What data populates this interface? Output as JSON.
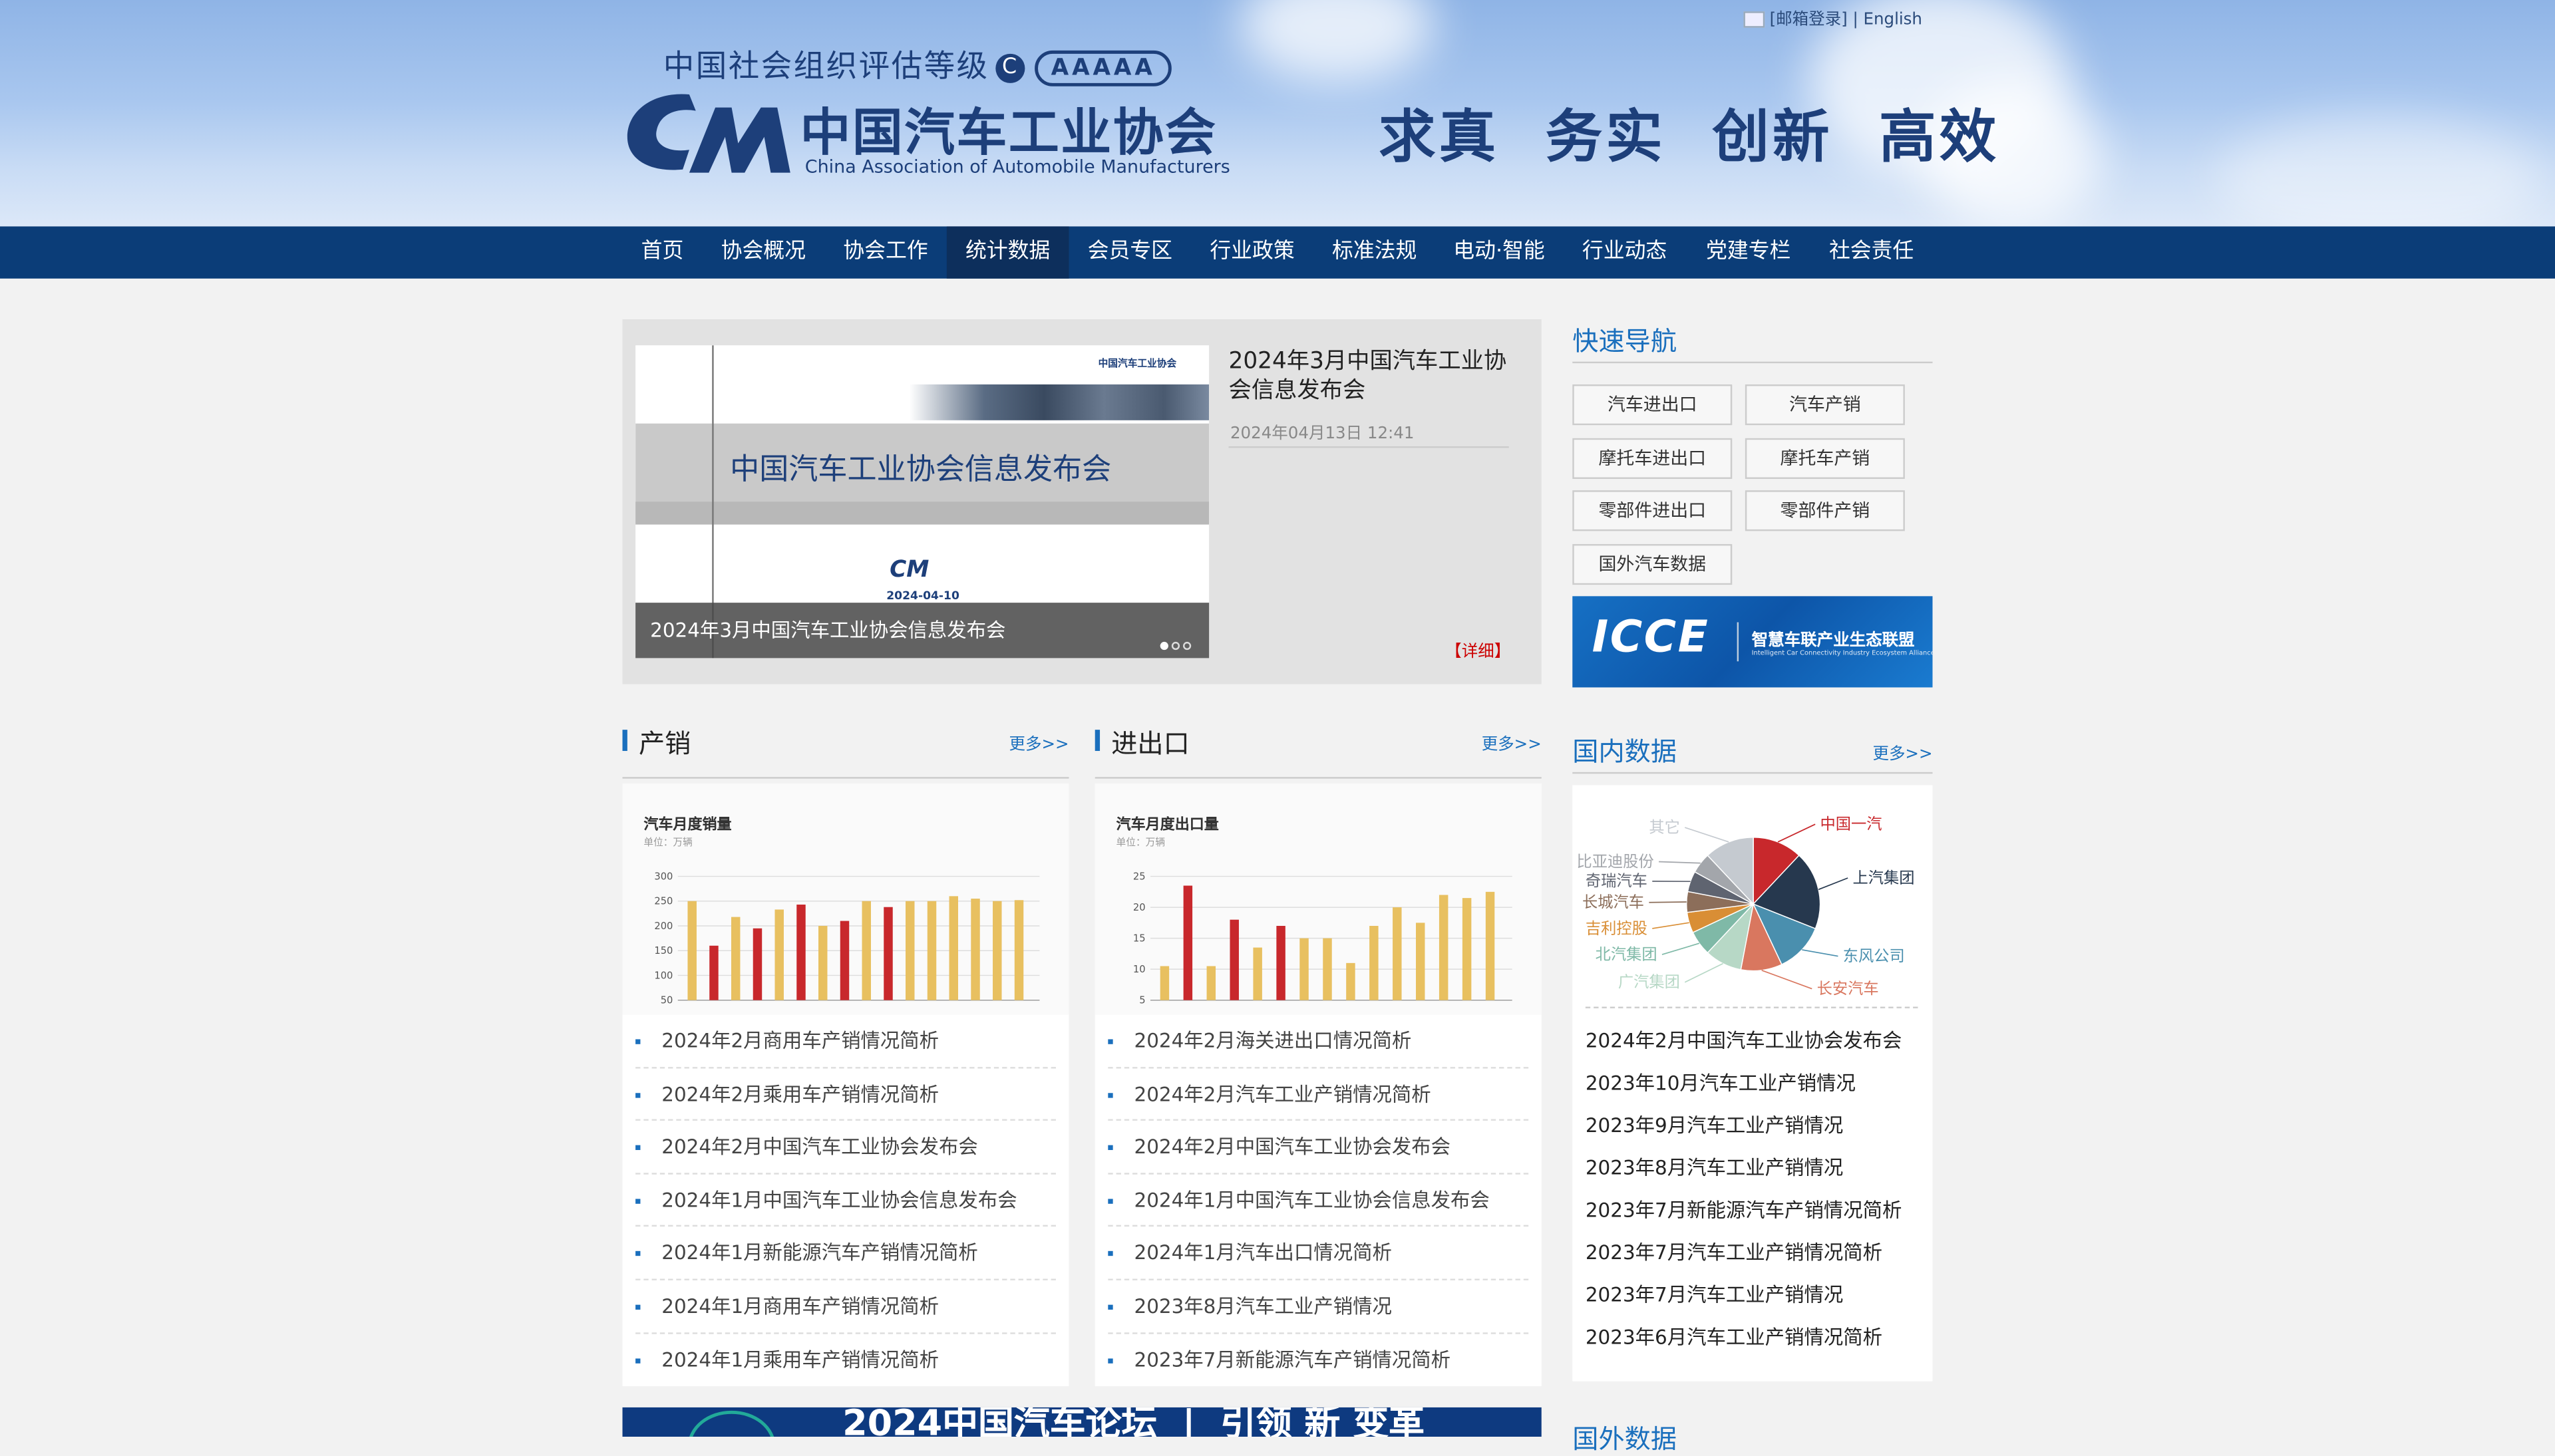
{
  "top_links": {
    "mail_login": "[邮箱登录]",
    "english": "| English"
  },
  "header": {
    "rating_text": "中国社会组织评估等级",
    "rating_mark": "C",
    "rating_grade": "AAAAA",
    "logo_mark": "CAM",
    "org_name_cn": "中国汽车工业协会",
    "org_name_en": "China Association of Automobile Manufacturers",
    "slogan": "求真  务实  创新  高效"
  },
  "nav": {
    "items": [
      "首页",
      "协会概况",
      "协会工作",
      "统计数据",
      "会员专区",
      "行业政策",
      "标准法规",
      "电动·智能",
      "行业动态",
      "党建专栏",
      "社会责任"
    ],
    "active": "统计数据"
  },
  "featured": {
    "image_logo_text": "中国汽车工业协会",
    "image_title": "中国汽车工业协会信息发布会",
    "image_cm": "CM",
    "image_date": "2024-04-10",
    "caption": "2024年3月中国汽车工业协会信息发布会",
    "title": "2024年3月中国汽车工业协会信息发布会",
    "date": "2024年04月13日 12:41",
    "detail_label": "【详细】",
    "slide_count": 3,
    "active_slide": 1
  },
  "sales_section": {
    "title": "产销",
    "more": "更多>>",
    "chart_title": "汽车月度销量",
    "chart_unit": "单位：万辆",
    "items": [
      "2024年2月商用车产销情况简析",
      "2024年2月乘用车产销情况简析",
      "2024年2月中国汽车工业协会发布会",
      "2024年1月中国汽车工业协会信息发布会",
      "2024年1月新能源汽车产销情况简析",
      "2024年1月商用车产销情况简析",
      "2024年1月乘用车产销情况简析"
    ]
  },
  "trade_section": {
    "title": "进出口",
    "more": "更多>>",
    "chart_title": "汽车月度出口量",
    "chart_unit": "单位：万辆",
    "items": [
      "2024年2月海关进出口情况简析",
      "2024年2月汽车工业产销情况简析",
      "2024年2月中国汽车工业协会发布会",
      "2024年1月中国汽车工业协会信息发布会",
      "2024年1月汽车出口情况简析",
      "2023年8月汽车工业产销情况",
      "2023年7月新能源汽车产销情况简析"
    ]
  },
  "quick_nav": {
    "title": "快速导航",
    "buttons": [
      "汽车进出口",
      "汽车产销",
      "摩托车进出口",
      "摩托车产销",
      "零部件进出口",
      "零部件产销",
      "国外汽车数据"
    ]
  },
  "icce_banner": {
    "logo_text": "ICCE",
    "cn": "智慧车联产业生态联盟",
    "en": "Intelligent Car Connectivity Industry Ecosystem Alliance"
  },
  "domestic": {
    "title": "国内数据",
    "more": "更多>>",
    "items": [
      "2024年2月中国汽车工业协会发布会",
      "2023年10月汽车工业产销情况",
      "2023年9月汽车工业产销情况",
      "2023年8月汽车工业产销情况",
      "2023年7月新能源汽车产销情况简析",
      "2023年7月汽车工业产销情况简析",
      "2023年7月汽车工业产销情况",
      "2023年6月汽车工业产销情况简析"
    ]
  },
  "bottom": {
    "banner_text": "2024中国汽车论坛  |  引领 新 变革",
    "foreign_title": "国外数据"
  },
  "colors": {
    "nav_bg": "#0b3d78",
    "accent": "#1a6fbd",
    "bar_gold": "#e8c060",
    "bar_red": "#c8282c"
  },
  "chart_data": [
    {
      "type": "bar",
      "title": "汽车月度销量",
      "ylabel": "单位：万辆",
      "ylim": [
        50,
        300
      ],
      "yticks": [
        50,
        100,
        150,
        200,
        250,
        300
      ],
      "series": [
        {
          "values": [
            250,
            null,
            218,
            null,
            233,
            null,
            200,
            null,
            250,
            null,
            250,
            250,
            260,
            255,
            250,
            252
          ]
        },
        {
          "values": [
            null,
            160,
            null,
            195,
            null,
            243,
            null,
            210,
            null,
            238,
            null,
            null,
            null,
            null,
            null,
            null
          ]
        }
      ]
    },
    {
      "type": "bar",
      "title": "汽车月度出口量",
      "ylabel": "单位：万辆",
      "ylim": [
        5,
        25
      ],
      "yticks": [
        5,
        10,
        15,
        20,
        25
      ],
      "series": [
        {
          "values": [
            10.5,
            null,
            10.5,
            null,
            13.5,
            null,
            15,
            15,
            11,
            17,
            20,
            17.5,
            22,
            21.5,
            22.5
          ]
        },
        {
          "values": [
            null,
            23.5,
            null,
            18,
            null,
            17,
            null,
            null,
            null,
            null,
            null,
            null,
            null,
            null,
            null
          ]
        }
      ]
    },
    {
      "type": "pie",
      "labels": [
        "中国一汽",
        "上汽集团",
        "东风公司",
        "长安汽车",
        "广汽集团",
        "北汽集团",
        "吉利控股",
        "长城汽车",
        "奇瑞汽车",
        "比亚迪股份",
        "其它"
      ],
      "values": [
        12,
        19,
        12,
        10,
        9,
        6,
        5,
        5,
        5,
        5,
        12
      ],
      "colors": [
        "#c8282c",
        "#26384e",
        "#4a8fae",
        "#d9775f",
        "#b7d8c6",
        "#7fb9a7",
        "#d98e35",
        "#8c6e5a",
        "#5f6470",
        "#a3a6ab",
        "#c5cad0"
      ]
    }
  ]
}
